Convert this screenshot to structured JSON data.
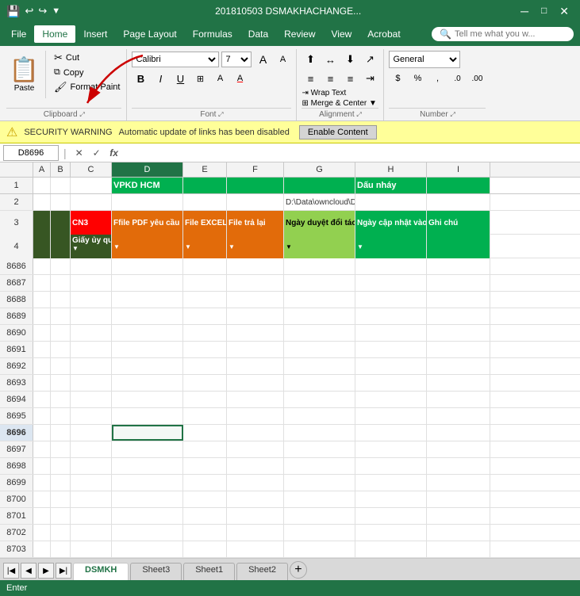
{
  "titlebar": {
    "filename": "201810503 DSMAKHACHANGE...",
    "save_icon": "💾",
    "undo_icon": "↩",
    "redo_icon": "↪"
  },
  "menubar": {
    "items": [
      "File",
      "Home",
      "Insert",
      "Page Layout",
      "Formulas",
      "Data",
      "Review",
      "View",
      "Acrobat"
    ],
    "active": "Home",
    "search_placeholder": "Tell me what you w..."
  },
  "ribbon": {
    "clipboard": {
      "paste_label": "Paste",
      "cut_label": "Cut",
      "copy_label": "Copy",
      "format_paint_label": "Format Paint"
    },
    "font": {
      "font_name": "Calibri",
      "font_size": "7",
      "bold": "B",
      "italic": "I",
      "underline": "U"
    },
    "alignment": {
      "wrap_text": "Wrap Text",
      "merge_center": "Merge & Center"
    },
    "number": {
      "format": "General"
    }
  },
  "security": {
    "icon": "⚠",
    "bold_text": "SECURITY WARNING",
    "detail_text": "Automatic update of links has been disabled",
    "button_label": "Enable Content"
  },
  "formula_bar": {
    "cell_ref": "D8696",
    "cancel_icon": "✕",
    "confirm_icon": "✓",
    "fx_icon": "fx"
  },
  "columns": {
    "headers": [
      "",
      "A",
      "B",
      "C",
      "D",
      "E",
      "F",
      "G",
      "H",
      "I"
    ]
  },
  "header_rows": {
    "row1": {
      "d": "VPKD HCM",
      "h": "Dấu nháy"
    },
    "row2": {
      "g": "D:\\Data\\owncloud\\DS Ma Khach Hang\\"
    },
    "row3": {
      "c": "CN3",
      "d": "Ffile PDF yêu cầu",
      "e": "File EXCEL",
      "f": "File trả lại",
      "g": "Ngày duyệt đổi tác",
      "h": "Ngày cập nhật vào drones",
      "i": "Ghi chú"
    },
    "row4_labels": {
      "c": "Giấy ủy quyền"
    }
  },
  "spreadsheet": {
    "rows": [
      {
        "num": "8686",
        "cells": [
          "",
          "",
          "",
          "",
          "",
          "",
          "",
          "",
          ""
        ]
      },
      {
        "num": "8687",
        "cells": [
          "",
          "",
          "",
          "",
          "",
          "",
          "",
          "",
          ""
        ]
      },
      {
        "num": "8688",
        "cells": [
          "",
          "",
          "",
          "",
          "",
          "",
          "",
          "",
          ""
        ]
      },
      {
        "num": "8689",
        "cells": [
          "",
          "",
          "",
          "",
          "",
          "",
          "",
          "",
          ""
        ]
      },
      {
        "num": "8690",
        "cells": [
          "",
          "",
          "",
          "",
          "",
          "",
          "",
          "",
          ""
        ]
      },
      {
        "num": "8691",
        "cells": [
          "",
          "",
          "",
          "",
          "",
          "",
          "",
          "",
          ""
        ]
      },
      {
        "num": "8692",
        "cells": [
          "",
          "",
          "",
          "",
          "",
          "",
          "",
          "",
          ""
        ]
      },
      {
        "num": "8693",
        "cells": [
          "",
          "",
          "",
          "",
          "",
          "",
          "",
          "",
          ""
        ]
      },
      {
        "num": "8694",
        "cells": [
          "",
          "",
          "",
          "",
          "",
          "",
          "",
          "",
          ""
        ]
      },
      {
        "num": "8695",
        "cells": [
          "",
          "",
          "",
          "",
          "",
          "",
          "",
          "",
          ""
        ]
      },
      {
        "num": "8696",
        "cells": [
          "",
          "",
          "",
          "",
          "",
          "",
          "",
          "",
          ""
        ],
        "selected_col": "d"
      },
      {
        "num": "8697",
        "cells": [
          "",
          "",
          "",
          "",
          "",
          "",
          "",
          "",
          ""
        ]
      },
      {
        "num": "8698",
        "cells": [
          "",
          "",
          "",
          "",
          "",
          "",
          "",
          "",
          ""
        ]
      },
      {
        "num": "8699",
        "cells": [
          "",
          "",
          "",
          "",
          "",
          "",
          "",
          "",
          ""
        ]
      },
      {
        "num": "8700",
        "cells": [
          "",
          "",
          "",
          "",
          "",
          "",
          "",
          "",
          ""
        ]
      },
      {
        "num": "8701",
        "cells": [
          "",
          "",
          "",
          "",
          "",
          "",
          "",
          "",
          ""
        ]
      },
      {
        "num": "8702",
        "cells": [
          "",
          "",
          "",
          "",
          "",
          "",
          "",
          "",
          ""
        ]
      },
      {
        "num": "8703",
        "cells": [
          "",
          "",
          "",
          "",
          "",
          "",
          "",
          "",
          ""
        ]
      }
    ]
  },
  "sheets": {
    "tabs": [
      "DSMKH",
      "Sheet3",
      "Sheet1",
      "Sheet2"
    ],
    "active": "DSMKH"
  },
  "status": {
    "text": "Enter"
  }
}
